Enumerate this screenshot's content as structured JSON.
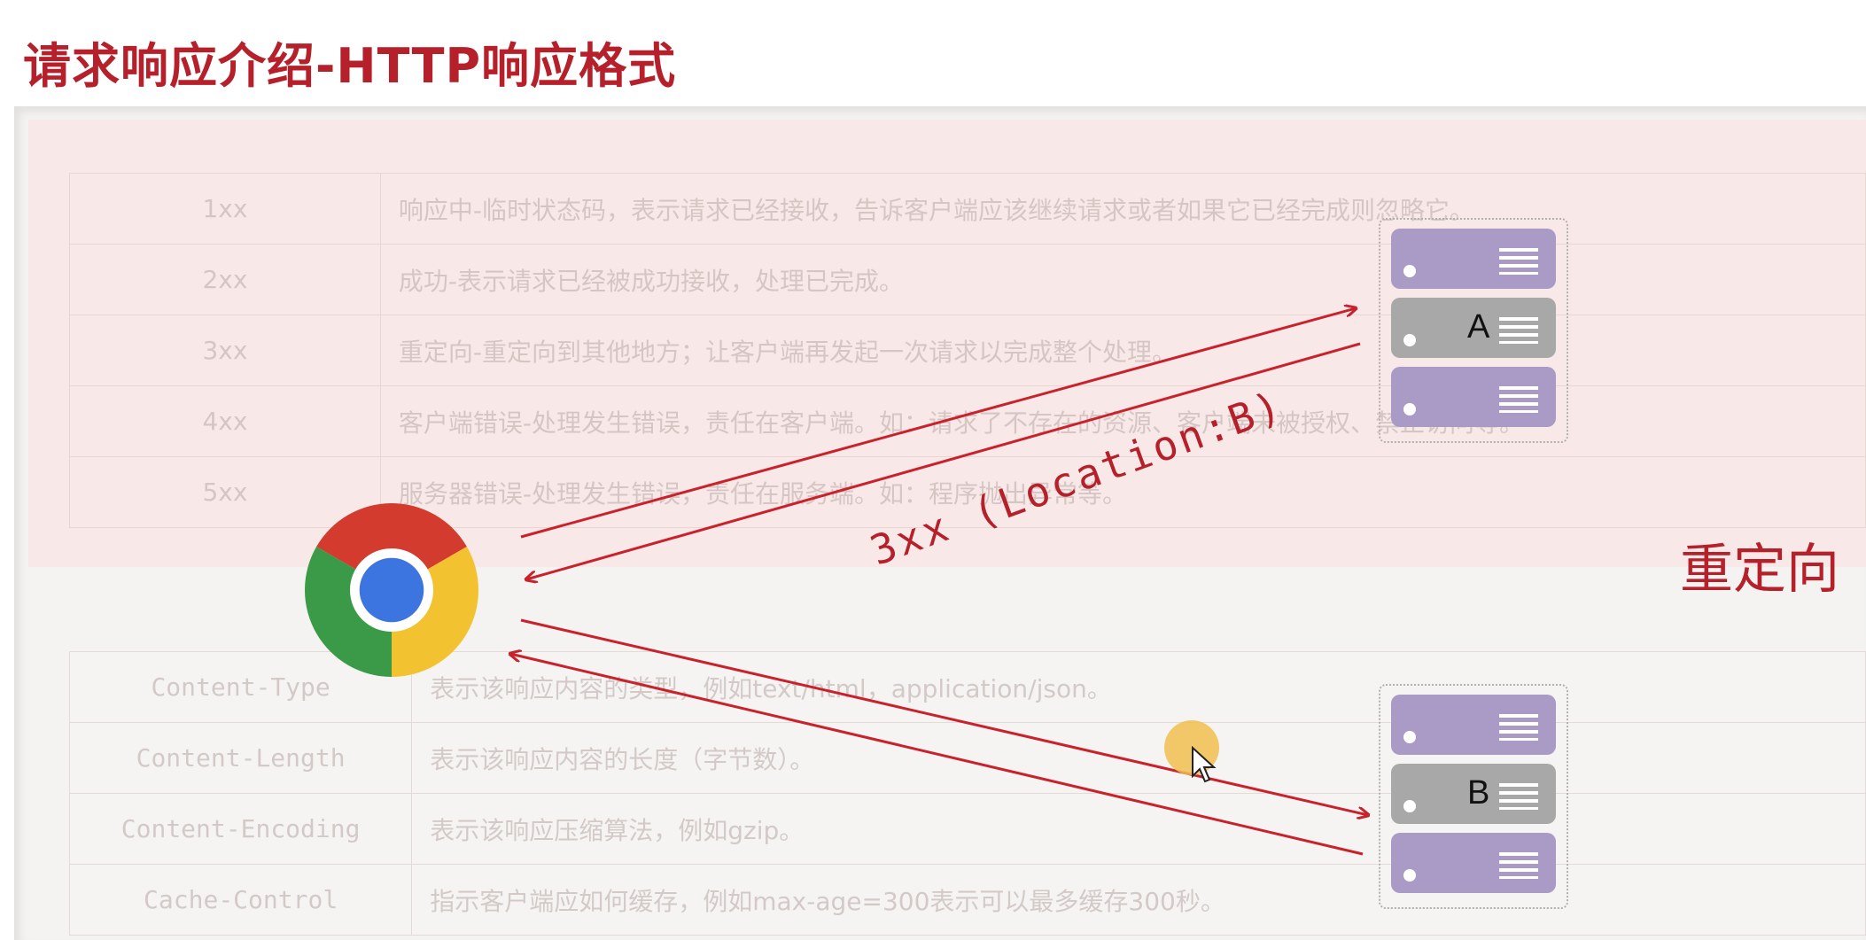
{
  "page": {
    "title": "请求响应介绍-HTTP响应格式"
  },
  "status_table": {
    "rows": [
      {
        "code": "1xx",
        "desc": "响应中-临时状态码，表示请求已经接收，告诉客户端应该继续请求或者如果它已经完成则忽略它。"
      },
      {
        "code": "2xx",
        "desc": "成功-表示请求已经被成功接收，处理已完成。"
      },
      {
        "code": "3xx",
        "desc": "重定向-重定向到其他地方；让客户端再发起一次请求以完成整个处理。"
      },
      {
        "code": "4xx",
        "desc": "客户端错误-处理发生错误，责任在客户端。如：请求了不存在的资源、客户端未被授权、禁止访问等。"
      },
      {
        "code": "5xx",
        "desc": "服务器错误-处理发生错误，责任在服务端。如：程序抛出异常等。"
      }
    ]
  },
  "header_table": {
    "rows": [
      {
        "name": "Content-Type",
        "desc": "表示该响应内容的类型，例如text/html，application/json。"
      },
      {
        "name": "Content-Length",
        "desc": "表示该响应内容的长度（字节数）。"
      },
      {
        "name": "Content-Encoding",
        "desc": "表示该响应压缩算法，例如gzip。"
      },
      {
        "name": "Cache-Control",
        "desc": "指示客户端应如何缓存，例如max-age=300表示可以最多缓存300秒。"
      }
    ]
  },
  "diagram": {
    "server_a_label": "A",
    "server_b_label": "B",
    "response_label": "3xx (Location:B)",
    "concept_label": "重定向",
    "browser_icon": "chrome-icon",
    "server_icon": "server-rack-icon"
  },
  "colors": {
    "accent": "#b5202a",
    "server_purple": "#a99ac6",
    "server_gray": "#a8a8a8"
  }
}
